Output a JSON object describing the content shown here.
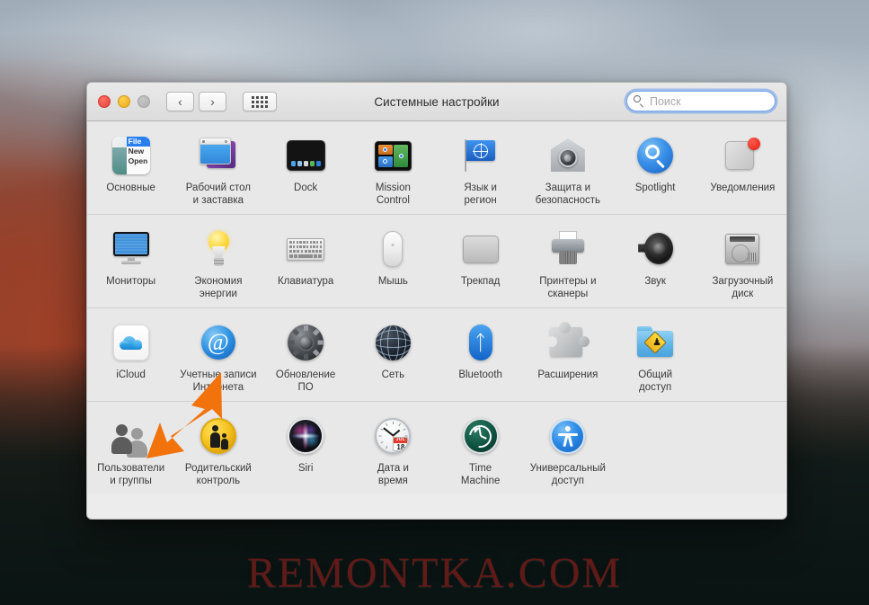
{
  "window": {
    "title": "Системные настройки",
    "traffic_lights": [
      "close",
      "minimize",
      "zoom"
    ],
    "nav_back": "‹",
    "nav_forward": "›",
    "grid_button": "show-all-grid"
  },
  "search": {
    "placeholder": "Поиск",
    "value": "",
    "focused": true,
    "accent": "#639beb"
  },
  "rows": [
    {
      "items": [
        {
          "label": "Основные",
          "icon": "general-icon"
        },
        {
          "label": "Рабочий стол\nи заставка",
          "icon": "desktop-screensaver-icon"
        },
        {
          "label": "Dock",
          "icon": "dock-icon"
        },
        {
          "label": "Mission\nControl",
          "icon": "mission-control-icon"
        },
        {
          "label": "Язык и\nрегион",
          "icon": "language-region-icon"
        },
        {
          "label": "Защита и\nбезопасность",
          "icon": "security-privacy-icon"
        },
        {
          "label": "Spotlight",
          "icon": "spotlight-icon"
        },
        {
          "label": "Уведомления",
          "icon": "notifications-icon"
        }
      ]
    },
    {
      "items": [
        {
          "label": "Мониторы",
          "icon": "displays-icon"
        },
        {
          "label": "Экономия\nэнергии",
          "icon": "energy-saver-icon"
        },
        {
          "label": "Клавиатура",
          "icon": "keyboard-icon"
        },
        {
          "label": "Мышь",
          "icon": "mouse-icon"
        },
        {
          "label": "Трекпад",
          "icon": "trackpad-icon"
        },
        {
          "label": "Принтеры и\nсканеры",
          "icon": "printers-scanners-icon"
        },
        {
          "label": "Звук",
          "icon": "sound-icon"
        },
        {
          "label": "Загрузочный\nдиск",
          "icon": "startup-disk-icon"
        }
      ]
    },
    {
      "items": [
        {
          "label": "iCloud",
          "icon": "icloud-icon"
        },
        {
          "label": "Учетные записи\nИнтернета",
          "icon": "internet-accounts-icon"
        },
        {
          "label": "Обновление\nПО",
          "icon": "software-update-icon"
        },
        {
          "label": "Сеть",
          "icon": "network-icon"
        },
        {
          "label": "Bluetooth",
          "icon": "bluetooth-icon"
        },
        {
          "label": "Расширения",
          "icon": "extensions-icon"
        },
        {
          "label": "Общий\nдоступ",
          "icon": "sharing-icon"
        }
      ]
    },
    {
      "items": [
        {
          "label": "Пользователи\nи группы",
          "icon": "users-groups-icon"
        },
        {
          "label": "Родительский\nконтроль",
          "icon": "parental-controls-icon"
        },
        {
          "label": "Siri",
          "icon": "siri-icon"
        },
        {
          "label": "Дата и\nвремя",
          "icon": "date-time-icon"
        },
        {
          "label": "Time\nMachine",
          "icon": "time-machine-icon"
        },
        {
          "label": "Универсальный\nдоступ",
          "icon": "accessibility-icon"
        }
      ]
    }
  ],
  "icon_details": {
    "general_menu": {
      "line1": "File",
      "line2": "New",
      "line3": "Open"
    },
    "date_time": {
      "month": "JUL",
      "day": "18"
    }
  },
  "annotation": {
    "arrow_color": "#f2720c",
    "points_to": "users-groups-icon"
  },
  "watermark": {
    "text": "REMONTKA.COM",
    "color": "#961e1c"
  }
}
